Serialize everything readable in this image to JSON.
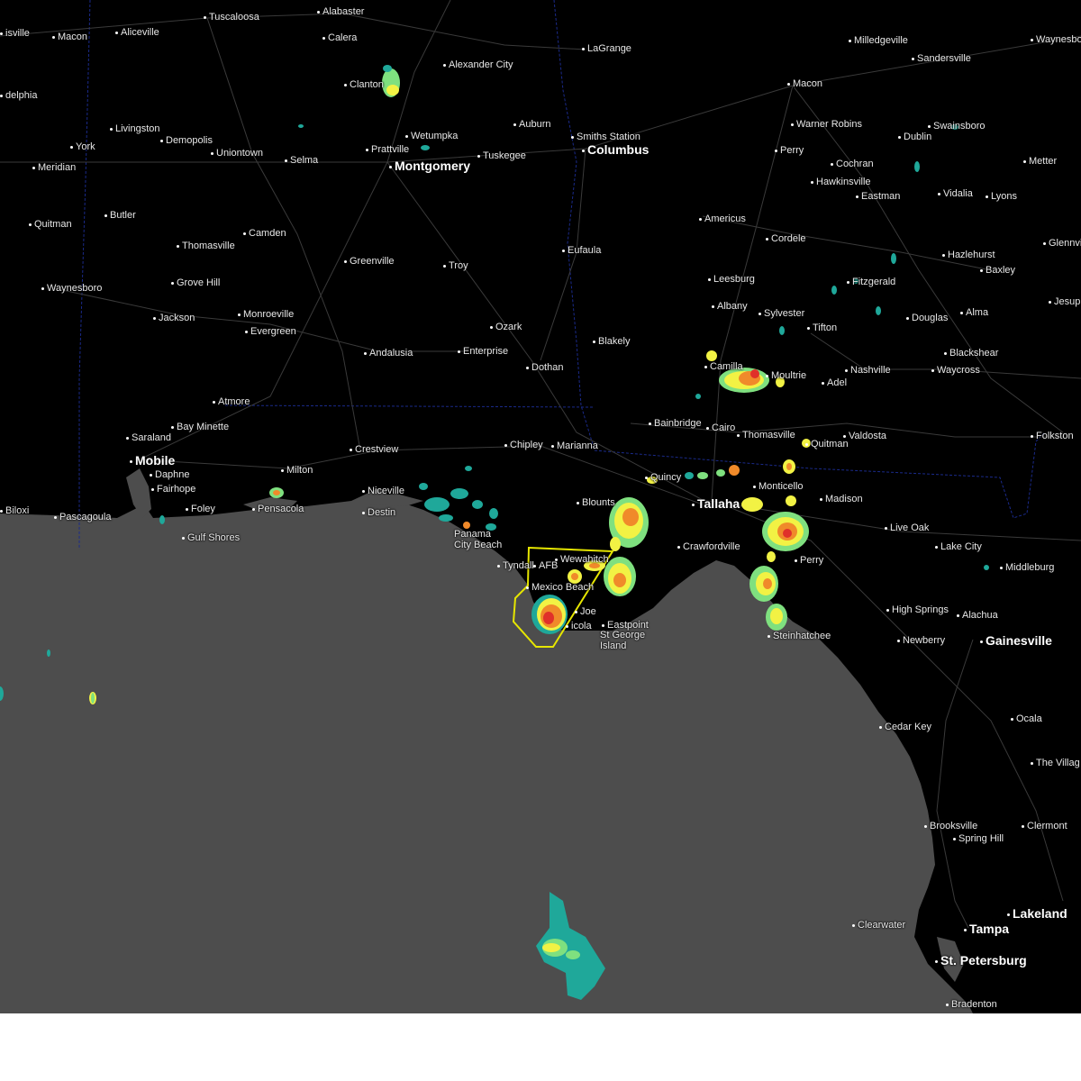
{
  "colors": {
    "land": "#000000",
    "water": "#4d4d4d",
    "roads": "#3a3a3a",
    "state_border": "#1a2a8a",
    "warning_polygon": "#e6e600",
    "radar_light": "#1fa89a",
    "radar_mid": "#7fe07f",
    "radar_yellow": "#f2f244",
    "radar_orange": "#f08a2a",
    "radar_red": "#e0302a",
    "background_bottom": "#ffffff"
  },
  "cities": [
    {
      "id": "lisville",
      "label": "isville"
    },
    {
      "id": "macon-ms",
      "label": "Macon"
    },
    {
      "id": "aliceville",
      "label": "Aliceville"
    },
    {
      "id": "tuscaloosa",
      "label": "Tuscaloosa"
    },
    {
      "id": "alabaster",
      "label": "Alabaster"
    },
    {
      "id": "calera",
      "label": "Calera"
    },
    {
      "id": "lagrange",
      "label": "LaGrange"
    },
    {
      "id": "alexander-city",
      "label": "Alexander City"
    },
    {
      "id": "milledgeville",
      "label": "Milledgeville"
    },
    {
      "id": "waynesboro-ga",
      "label": "Waynesbo"
    },
    {
      "id": "sandersville",
      "label": "Sandersville"
    },
    {
      "id": "clanton",
      "label": "Clanton"
    },
    {
      "id": "philadelphia",
      "label": "delphia"
    },
    {
      "id": "macon-ga",
      "label": "Macon"
    },
    {
      "id": "livingston",
      "label": "Livingston"
    },
    {
      "id": "auburn",
      "label": "Auburn"
    },
    {
      "id": "smiths-station",
      "label": "Smiths Station"
    },
    {
      "id": "warner-robins",
      "label": "Warner Robins"
    },
    {
      "id": "swainsboro",
      "label": "Swainsboro"
    },
    {
      "id": "york",
      "label": "York"
    },
    {
      "id": "demopolis",
      "label": "Demopolis"
    },
    {
      "id": "wetumpka",
      "label": "Wetumpka"
    },
    {
      "id": "dublin",
      "label": "Dublin"
    },
    {
      "id": "columbus",
      "label": "Columbus"
    },
    {
      "id": "prattville",
      "label": "Prattville"
    },
    {
      "id": "uniontown",
      "label": "Uniontown"
    },
    {
      "id": "perry-ga",
      "label": "Perry"
    },
    {
      "id": "tuskegee",
      "label": "Tuskegee"
    },
    {
      "id": "selma",
      "label": "Selma"
    },
    {
      "id": "montgomery",
      "label": "Montgomery"
    },
    {
      "id": "meridian",
      "label": "Meridian"
    },
    {
      "id": "cochran",
      "label": "Cochran"
    },
    {
      "id": "metter",
      "label": "Metter"
    },
    {
      "id": "hawkinsville",
      "label": "Hawkinsville"
    },
    {
      "id": "eastman",
      "label": "Eastman"
    },
    {
      "id": "vidalia",
      "label": "Vidalia"
    },
    {
      "id": "lyons",
      "label": "Lyons"
    },
    {
      "id": "butler",
      "label": "Butler"
    },
    {
      "id": "americus",
      "label": "Americus"
    },
    {
      "id": "quitman-ms",
      "label": "Quitman"
    },
    {
      "id": "camden",
      "label": "Camden"
    },
    {
      "id": "cordele",
      "label": "Cordele"
    },
    {
      "id": "glennville",
      "label": "Glennvill"
    },
    {
      "id": "thomasville-al",
      "label": "Thomasville"
    },
    {
      "id": "eufaula",
      "label": "Eufaula"
    },
    {
      "id": "hazlehurst",
      "label": "Hazlehurst"
    },
    {
      "id": "greenville",
      "label": "Greenville"
    },
    {
      "id": "troy",
      "label": "Troy"
    },
    {
      "id": "baxley",
      "label": "Baxley"
    },
    {
      "id": "leesburg",
      "label": "Leesburg"
    },
    {
      "id": "fitzgerald",
      "label": "Fitzgerald"
    },
    {
      "id": "grove-hill",
      "label": "Grove Hill"
    },
    {
      "id": "jesup",
      "label": "Jesup"
    },
    {
      "id": "waynesboro-ms",
      "label": "Waynesboro"
    },
    {
      "id": "albany",
      "label": "Albany"
    },
    {
      "id": "alma",
      "label": "Alma"
    },
    {
      "id": "monroeville",
      "label": "Monroeville"
    },
    {
      "id": "jackson",
      "label": "Jackson"
    },
    {
      "id": "sylvester",
      "label": "Sylvester"
    },
    {
      "id": "douglas",
      "label": "Douglas"
    },
    {
      "id": "ozark",
      "label": "Ozark"
    },
    {
      "id": "tifton",
      "label": "Tifton"
    },
    {
      "id": "evergreen",
      "label": "Evergreen"
    },
    {
      "id": "blakely",
      "label": "Blakely"
    },
    {
      "id": "andalusia",
      "label": "Andalusia"
    },
    {
      "id": "enterprise",
      "label": "Enterprise"
    },
    {
      "id": "blackshear",
      "label": "Blackshear"
    },
    {
      "id": "waycross",
      "label": "Waycross"
    },
    {
      "id": "camilla",
      "label": "Camilla"
    },
    {
      "id": "dothan",
      "label": "Dothan"
    },
    {
      "id": "nashville",
      "label": "Nashville"
    },
    {
      "id": "moultrie",
      "label": "Moultrie"
    },
    {
      "id": "adel",
      "label": "Adel"
    },
    {
      "id": "atmore",
      "label": "Atmore"
    },
    {
      "id": "bainbridge",
      "label": "Bainbridge"
    },
    {
      "id": "cairo",
      "label": "Cairo"
    },
    {
      "id": "bay-minette",
      "label": "Bay Minette"
    },
    {
      "id": "valdosta",
      "label": "Valdosta"
    },
    {
      "id": "thomasville-ga",
      "label": "Thomasville"
    },
    {
      "id": "saraland",
      "label": "Saraland"
    },
    {
      "id": "folkston",
      "label": "Folkston"
    },
    {
      "id": "quitman-ga",
      "label": "Quitman"
    },
    {
      "id": "crestview",
      "label": "Crestview"
    },
    {
      "id": "chipley",
      "label": "Chipley"
    },
    {
      "id": "marianna",
      "label": "Marianna"
    },
    {
      "id": "mobile",
      "label": "Mobile"
    },
    {
      "id": "milton",
      "label": "Milton"
    },
    {
      "id": "daphne",
      "label": "Daphne"
    },
    {
      "id": "quincy",
      "label": "Quincy"
    },
    {
      "id": "fairhope",
      "label": "Fairhope"
    },
    {
      "id": "monticello",
      "label": "Monticello"
    },
    {
      "id": "niceville",
      "label": "Niceville"
    },
    {
      "id": "blountstown",
      "label": "Blounts"
    },
    {
      "id": "madison",
      "label": "Madison"
    },
    {
      "id": "tallahassee",
      "label": "Tallaha"
    },
    {
      "id": "biloxi",
      "label": "Biloxi"
    },
    {
      "id": "pascagoula",
      "label": "Pascagoula"
    },
    {
      "id": "foley",
      "label": "Foley"
    },
    {
      "id": "pensacola",
      "label": "Pensacola"
    },
    {
      "id": "destin",
      "label": "Destin"
    },
    {
      "id": "live-oak",
      "label": "Live Oak"
    },
    {
      "id": "gulf-shores",
      "label": "Gulf Shores"
    },
    {
      "id": "panama-city-beach",
      "label": "Panama\nCity Beach"
    },
    {
      "id": "lake-city",
      "label": "Lake City"
    },
    {
      "id": "crawfordville",
      "label": "Crawfordville"
    },
    {
      "id": "perry-fl",
      "label": "Perry"
    },
    {
      "id": "wewahitchka",
      "label": "Wewahitch"
    },
    {
      "id": "tyndall",
      "label": "Tyndall"
    },
    {
      "id": "afb",
      "label": "AFB"
    },
    {
      "id": "middleburg",
      "label": "Middleburg"
    },
    {
      "id": "mexico-beach",
      "label": "Mexico Beach"
    },
    {
      "id": "high-springs",
      "label": "High Springs"
    },
    {
      "id": "port-st-joe",
      "label": "Joe"
    },
    {
      "id": "alachua",
      "label": "Alachua"
    },
    {
      "id": "eastpoint",
      "label": "Eastpoint"
    },
    {
      "id": "apalachicola",
      "label": "icola"
    },
    {
      "id": "st-george-island",
      "label": "St George\nIsland"
    },
    {
      "id": "steinhatchee",
      "label": "Steinhatchee"
    },
    {
      "id": "newberry",
      "label": "Newberry"
    },
    {
      "id": "gainesville",
      "label": "Gainesville"
    },
    {
      "id": "ocala",
      "label": "Ocala"
    },
    {
      "id": "cedar-key",
      "label": "Cedar Key"
    },
    {
      "id": "the-villages",
      "label": "The Villag"
    },
    {
      "id": "brooksville",
      "label": "Brooksville"
    },
    {
      "id": "clermont",
      "label": "Clermont"
    },
    {
      "id": "spring-hill",
      "label": "Spring Hill"
    },
    {
      "id": "lakeland",
      "label": "Lakeland"
    },
    {
      "id": "clearwater",
      "label": "Clearwater"
    },
    {
      "id": "tampa",
      "label": "Tampa"
    },
    {
      "id": "st-petersburg",
      "label": "St. Petersburg"
    },
    {
      "id": "bradenton",
      "label": "Bradenton"
    }
  ]
}
